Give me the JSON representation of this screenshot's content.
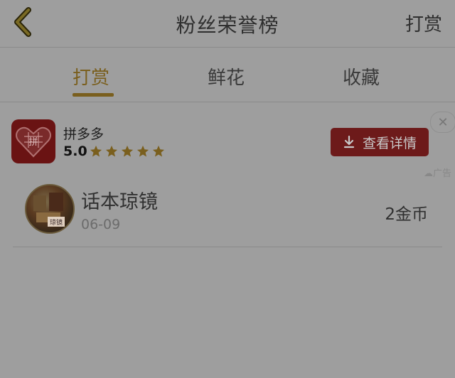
{
  "header": {
    "title": "粉丝荣誉榜",
    "right_action": "打赏"
  },
  "tabs": [
    {
      "label": "打赏",
      "active": true
    },
    {
      "label": "鲜花",
      "active": false
    },
    {
      "label": "收藏",
      "active": false
    }
  ],
  "ad": {
    "app_name": "拼多多",
    "logo_text": "拼",
    "rating": "5.0",
    "stars": 5,
    "button_label": "查看详情",
    "close_symbol": "✕",
    "tag": "广告"
  },
  "fans": [
    {
      "name": "话本琼镜",
      "date": "06-09",
      "amount": "2金币",
      "avatar_text": "琼镜"
    }
  ],
  "colors": {
    "accent": "#7a5f1e",
    "ad_button": "#6d1a1a",
    "background": "#9e9e9e"
  }
}
